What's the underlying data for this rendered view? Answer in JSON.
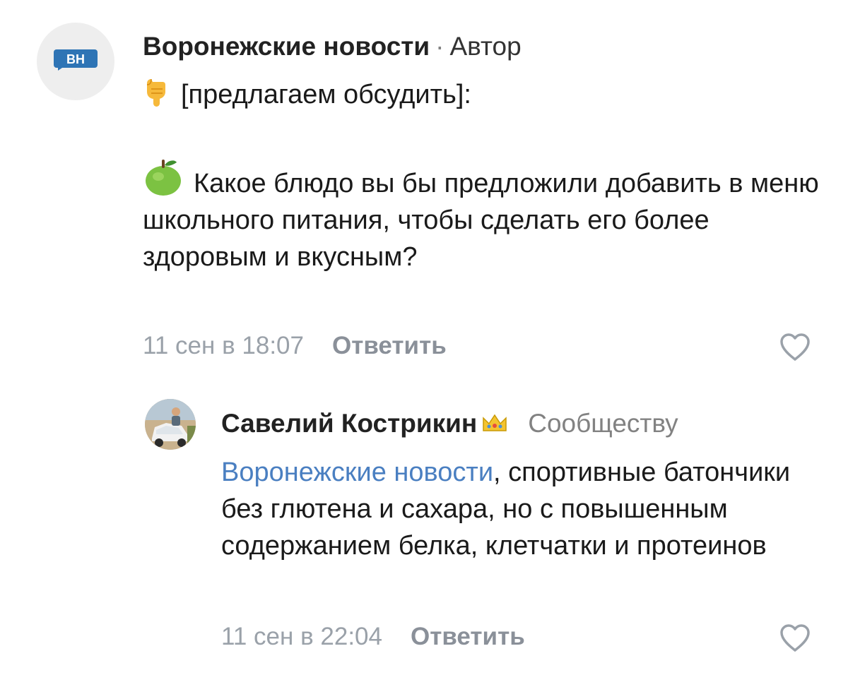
{
  "post_comment": {
    "avatar_text": "ВН",
    "author": "Воронежские новости",
    "separator": "·",
    "role": "Автор",
    "line1": "[предлагаем обсудить]:",
    "question": "Какое блюдо вы бы предложили добавить в меню школьного питания, чтобы сделать его более здоровым и вкусным?",
    "date": "11 сен в 18:07",
    "reply_label": "Ответить",
    "icons": {
      "pointer": "pointing-down-hand-icon",
      "apple": "green-apple-icon",
      "like": "heart-icon"
    }
  },
  "reply_comment": {
    "author": "Савелий Кострикин",
    "role": "Сообществу",
    "mention": "Воронежские новости",
    "text": ", спортивные батончики без глютена и сахара, но с повышенным содержанием белка, клетчатки и протеинов",
    "date": "11 сен в 22:04",
    "reply_label": "Ответить",
    "icons": {
      "crown": "crown-icon",
      "like": "heart-icon"
    }
  },
  "colors": {
    "mention_link": "#4a7fc1",
    "secondary_text": "#9aa1a9",
    "vk_blue": "#2e74b5"
  }
}
